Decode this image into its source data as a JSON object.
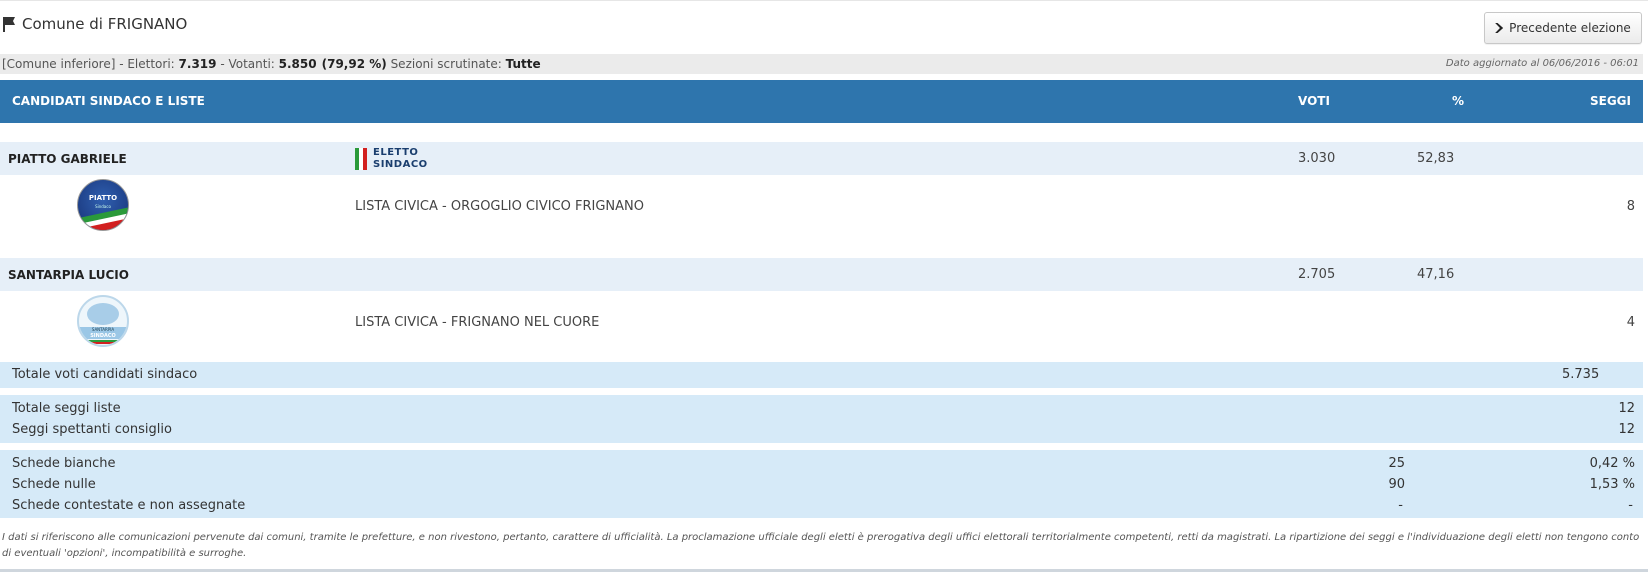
{
  "page": {
    "title": "Comune di FRIGNANO",
    "prev_button": "Precedente elezione"
  },
  "info": {
    "comune_tipo": "[Comune inferiore]",
    "elettori_label": " - Elettori: ",
    "elettori": "7.319",
    "votanti_label": " - Votanti: ",
    "votanti": "5.850",
    "votanti_pct": "(79,92 %)",
    "sezioni_label": " Sezioni scrutinate: ",
    "sezioni": "Tutte",
    "aggiornamento": "Dato aggiornato al 06/06/2016 - 06:01"
  },
  "header": {
    "col_candidati": "CANDIDATI SINDACO E LISTE",
    "col_voti": "VOTI",
    "col_pct": "%",
    "col_seggi": "SEGGI"
  },
  "candidates": [
    {
      "name": "PIATTO GABRIELE",
      "votes": "3.030",
      "pct": "52,83",
      "eletto": "ELETTO",
      "eletto_role": "SINDACO",
      "logo_text": "PIATTO",
      "logo_subtext": "Sindaco",
      "list_name": "LISTA CIVICA - ORGOGLIO CIVICO FRIGNANO",
      "list_seats": "8"
    },
    {
      "name": "SANTARPIA LUCIO",
      "votes": "2.705",
      "pct": "47,16",
      "logo_text": "SANTARPIA",
      "logo_subtext": "SINDACO",
      "list_name": "LISTA CIVICA - FRIGNANO NEL CUORE",
      "list_seats": "4"
    }
  ],
  "totals": {
    "voti_candidati_label": "Totale voti candidati sindaco",
    "voti_candidati": "5.735",
    "seggi_liste_label": "Totale seggi liste",
    "seggi_liste": "12",
    "seggi_consiglio_label": "Seggi spettanti consiglio",
    "seggi_consiglio": "12",
    "bianche_label": "Schede bianche",
    "bianche": "25",
    "bianche_pct": "0,42 %",
    "nulle_label": "Schede nulle",
    "nulle": "90",
    "nulle_pct": "1,53 %",
    "contestate_label": "Schede contestate e non assegnate",
    "contestate": "-",
    "contestate_pct": "-"
  },
  "note": "I dati si riferiscono alle comunicazioni pervenute dai comuni, tramite le prefetture, e non rivestono, pertanto, carattere di ufficialità. La proclamazione ufficiale degli eletti è prerogativa degli uffici elettorali territorialmente competenti, retti da magistrati. La ripartizione dei seggi e l'individuazione degli eletti non tengono conto di eventuali 'opzioni', incompatibilità e surroghe.",
  "colors": {
    "header_bg": "#2e75ad",
    "candidate_row_bg": "#e6eff8",
    "totals_bg": "#d6eaf8",
    "flag_green": "#2a9a3a",
    "flag_white": "#ffffff",
    "flag_red": "#d22020"
  }
}
